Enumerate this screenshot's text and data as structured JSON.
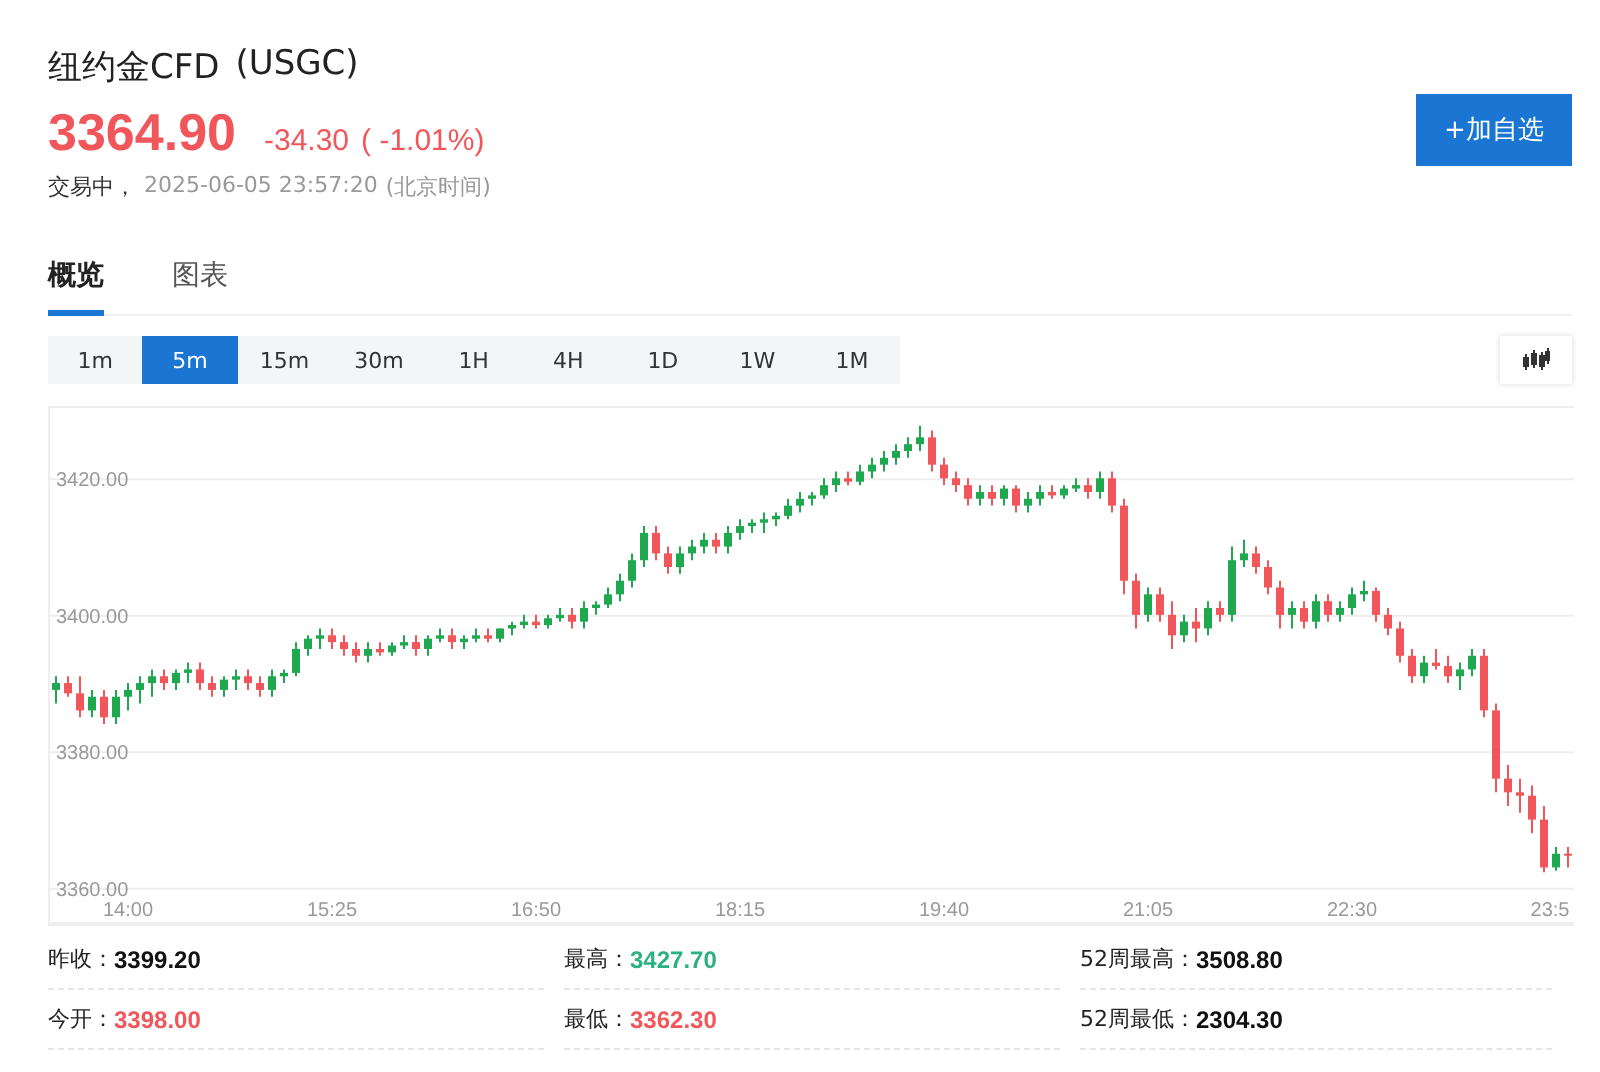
{
  "header": {
    "name": "纽约金CFD",
    "code": "(USGC)",
    "price": "3364.90",
    "change": "-34.30",
    "change_pct": "( -1.01%)",
    "status": "交易中，",
    "timestamp": "2025-06-05 23:57:20",
    "timezone": "(北京时间)",
    "watch_button": "+加自选"
  },
  "tabs": [
    {
      "label": "概览",
      "selected": true
    },
    {
      "label": "图表",
      "selected": false
    }
  ],
  "intervals": [
    {
      "label": "1m",
      "selected": false
    },
    {
      "label": "5m",
      "selected": true
    },
    {
      "label": "15m",
      "selected": false
    },
    {
      "label": "30m",
      "selected": false
    },
    {
      "label": "1H",
      "selected": false
    },
    {
      "label": "4H",
      "selected": false
    },
    {
      "label": "1D",
      "selected": false
    },
    {
      "label": "1W",
      "selected": false
    },
    {
      "label": "1M",
      "selected": false
    }
  ],
  "chart": {
    "chart_data": {
      "type": "candlestick",
      "categories": [
        null,
        null,
        null,
        null,
        null,
        null,
        "14:00",
        null,
        null,
        null,
        null,
        null,
        null,
        null,
        null,
        null,
        null,
        null,
        null,
        null,
        null,
        null,
        null,
        "15:25",
        null,
        null,
        null,
        null,
        null,
        null,
        null,
        null,
        null,
        null,
        null,
        null,
        null,
        null,
        null,
        null,
        "16:50",
        null,
        null,
        null,
        null,
        null,
        null,
        null,
        null,
        null,
        null,
        null,
        null,
        null,
        null,
        null,
        null,
        "18:15",
        null,
        null,
        null,
        null,
        null,
        null,
        null,
        null,
        null,
        null,
        null,
        null,
        null,
        null,
        null,
        null,
        "19:40",
        null,
        null,
        null,
        null,
        null,
        null,
        null,
        null,
        null,
        null,
        null,
        null,
        null,
        null,
        null,
        null,
        "21:05",
        null,
        null,
        null,
        null,
        null,
        null,
        null,
        null,
        null,
        null,
        null,
        null,
        null,
        null,
        null,
        null,
        "22:30",
        null,
        null,
        null,
        null,
        null,
        null,
        null,
        null,
        null,
        null,
        null,
        null,
        null,
        null,
        null,
        null,
        "23:5",
        null
      ],
      "ohlc": [
        [
          3389,
          3391,
          3387,
          3390
        ],
        [
          3390,
          3391,
          3388,
          3388.5
        ],
        [
          3388.5,
          3391,
          3385,
          3386
        ],
        [
          3386,
          3389,
          3385,
          3388
        ],
        [
          3388,
          3389,
          3384,
          3385
        ],
        [
          3385,
          3389,
          3384,
          3388
        ],
        [
          3388,
          3390,
          3386,
          3389
        ],
        [
          3389,
          3391,
          3387,
          3390
        ],
        [
          3390,
          3392,
          3388,
          3391
        ],
        [
          3391,
          3392,
          3389,
          3390
        ],
        [
          3390,
          3392,
          3389,
          3391.5
        ],
        [
          3391.5,
          3393,
          3390,
          3392
        ],
        [
          3392,
          3393,
          3389,
          3390
        ],
        [
          3390,
          3391,
          3388,
          3389
        ],
        [
          3389,
          3391,
          3388,
          3390.5
        ],
        [
          3390.5,
          3392,
          3389,
          3391
        ],
        [
          3391,
          3392,
          3389,
          3390
        ],
        [
          3390,
          3391,
          3388,
          3389
        ],
        [
          3389,
          3392,
          3388,
          3391
        ],
        [
          3391,
          3392,
          3390,
          3391.5
        ],
        [
          3391.5,
          3396,
          3391,
          3395
        ],
        [
          3395,
          3397,
          3394,
          3396.5
        ],
        [
          3396.5,
          3398,
          3395,
          3397
        ],
        [
          3397,
          3398,
          3395,
          3396
        ],
        [
          3396,
          3397,
          3394,
          3395
        ],
        [
          3395,
          3396,
          3393,
          3394
        ],
        [
          3394,
          3396,
          3393,
          3395
        ],
        [
          3395,
          3396,
          3394,
          3394.5
        ],
        [
          3394.5,
          3396,
          3394,
          3395.5
        ],
        [
          3395.5,
          3397,
          3395,
          3396
        ],
        [
          3396,
          3397,
          3394,
          3395
        ],
        [
          3395,
          3397,
          3394,
          3396.5
        ],
        [
          3396.5,
          3398,
          3396,
          3397
        ],
        [
          3397,
          3398,
          3395,
          3396
        ],
        [
          3396,
          3397,
          3395,
          3396.5
        ],
        [
          3396.5,
          3398,
          3396,
          3397
        ],
        [
          3397,
          3398,
          3396,
          3396.5
        ],
        [
          3396.5,
          3398,
          3396,
          3398
        ],
        [
          3398,
          3399,
          3397,
          3398.5
        ],
        [
          3398.5,
          3400,
          3398,
          3399
        ],
        [
          3399,
          3400,
          3398,
          3398.5
        ],
        [
          3398.5,
          3400,
          3398,
          3399.5
        ],
        [
          3399.5,
          3401,
          3399,
          3400
        ],
        [
          3400,
          3401,
          3398,
          3399
        ],
        [
          3399,
          3402,
          3398,
          3401
        ],
        [
          3401,
          3402,
          3400,
          3401.5
        ],
        [
          3401.5,
          3404,
          3401,
          3403
        ],
        [
          3403,
          3406,
          3402,
          3405
        ],
        [
          3405,
          3409,
          3404,
          3408
        ],
        [
          3408,
          3413,
          3407,
          3412
        ],
        [
          3412,
          3413,
          3408,
          3409
        ],
        [
          3409,
          3410,
          3406,
          3407
        ],
        [
          3407,
          3410,
          3406,
          3409
        ],
        [
          3409,
          3411,
          3408,
          3410
        ],
        [
          3410,
          3412,
          3409,
          3411
        ],
        [
          3411,
          3412,
          3409,
          3410
        ],
        [
          3410,
          3413,
          3409,
          3412
        ],
        [
          3412,
          3414,
          3411,
          3413
        ],
        [
          3413,
          3414,
          3412,
          3413.5
        ],
        [
          3413.5,
          3415,
          3412,
          3414
        ],
        [
          3414,
          3415,
          3413,
          3414.5
        ],
        [
          3414.5,
          3417,
          3414,
          3416
        ],
        [
          3416,
          3418,
          3415,
          3417
        ],
        [
          3417,
          3418,
          3416,
          3417.5
        ],
        [
          3417.5,
          3420,
          3417,
          3419
        ],
        [
          3419,
          3421,
          3418,
          3420
        ],
        [
          3420,
          3421,
          3419,
          3419.5
        ],
        [
          3419.5,
          3422,
          3419,
          3421
        ],
        [
          3421,
          3423,
          3420,
          3422
        ],
        [
          3422,
          3424,
          3421,
          3423
        ],
        [
          3423,
          3425,
          3422,
          3424
        ],
        [
          3424,
          3426,
          3423,
          3425
        ],
        [
          3425,
          3427.7,
          3424,
          3426
        ],
        [
          3426,
          3427,
          3421,
          3422
        ],
        [
          3422,
          3423,
          3419,
          3420
        ],
        [
          3420,
          3421,
          3418,
          3419
        ],
        [
          3419,
          3420,
          3416,
          3417
        ],
        [
          3417,
          3419,
          3416,
          3418
        ],
        [
          3418,
          3419,
          3416,
          3417
        ],
        [
          3417,
          3419,
          3416,
          3418.5
        ],
        [
          3418.5,
          3419,
          3415,
          3416
        ],
        [
          3416,
          3418,
          3415,
          3417
        ],
        [
          3417,
          3419,
          3416,
          3418
        ],
        [
          3418,
          3419,
          3417,
          3417.5
        ],
        [
          3417.5,
          3419,
          3417,
          3418.5
        ],
        [
          3418.5,
          3420,
          3418,
          3419
        ],
        [
          3419,
          3420,
          3417,
          3418
        ],
        [
          3418,
          3421,
          3417,
          3420
        ],
        [
          3420,
          3421,
          3415,
          3416
        ],
        [
          3416,
          3417,
          3403,
          3405
        ],
        [
          3405,
          3406,
          3398,
          3400
        ],
        [
          3400,
          3404,
          3399,
          3403
        ],
        [
          3403,
          3404,
          3399,
          3400
        ],
        [
          3400,
          3402,
          3395,
          3397
        ],
        [
          3397,
          3400,
          3396,
          3399
        ],
        [
          3399,
          3401,
          3396,
          3398
        ],
        [
          3398,
          3402,
          3397,
          3401
        ],
        [
          3401,
          3402,
          3399,
          3400
        ],
        [
          3400,
          3410,
          3399,
          3408
        ],
        [
          3408,
          3411,
          3407,
          3409
        ],
        [
          3409,
          3410,
          3406,
          3407
        ],
        [
          3407,
          3408,
          3403,
          3404
        ],
        [
          3404,
          3405,
          3398,
          3400
        ],
        [
          3400,
          3402,
          3398,
          3401
        ],
        [
          3401,
          3402,
          3398,
          3399
        ],
        [
          3399,
          3403,
          3398,
          3402
        ],
        [
          3402,
          3403,
          3399,
          3400
        ],
        [
          3400,
          3402,
          3399,
          3401
        ],
        [
          3401,
          3404,
          3400,
          3403
        ],
        [
          3403,
          3405,
          3402,
          3403.5
        ],
        [
          3403.5,
          3404,
          3399,
          3400
        ],
        [
          3400,
          3401,
          3397,
          3398
        ],
        [
          3398,
          3399,
          3393,
          3394
        ],
        [
          3394,
          3395,
          3390,
          3391
        ],
        [
          3391,
          3394,
          3390,
          3393
        ],
        [
          3393,
          3395,
          3392,
          3392.5
        ],
        [
          3392.5,
          3394,
          3390,
          3391
        ],
        [
          3391,
          3393,
          3389,
          3392
        ],
        [
          3392,
          3395,
          3391,
          3394
        ],
        [
          3394,
          3395,
          3385,
          3386
        ],
        [
          3386,
          3387,
          3374,
          3376
        ],
        [
          3376,
          3378,
          3372,
          3374
        ],
        [
          3374,
          3376,
          3371,
          3373.5
        ],
        [
          3373.5,
          3375,
          3368,
          3370
        ],
        [
          3370,
          3372,
          3362.3,
          3363
        ],
        [
          3363,
          3366,
          3362.5,
          3365
        ],
        [
          3365,
          3366,
          3363,
          3364.9
        ]
      ],
      "ylim": [
        3355,
        3430.3
      ],
      "grid": true,
      "yticks": [
        {
          "value": 3420,
          "label": "3420.00"
        },
        {
          "value": 3400,
          "label": "3400.00"
        },
        {
          "value": 3380,
          "label": "3380.00"
        },
        {
          "value": 3360,
          "label": "3360.00"
        }
      ]
    }
  },
  "stats": [
    {
      "label": "昨收：",
      "value": "3399.20",
      "color": "#111111"
    },
    {
      "label": "最高：",
      "value": "3427.70",
      "color": "#2bb17f"
    },
    {
      "label": "52周最高：",
      "value": "3508.80",
      "color": "#111111"
    },
    {
      "label": "今开：",
      "value": "3398.00",
      "color": "#f0565a"
    },
    {
      "label": "最低：",
      "value": "3362.30",
      "color": "#f0565a"
    },
    {
      "label": "52周最低：",
      "value": "2304.30",
      "color": "#111111"
    }
  ]
}
